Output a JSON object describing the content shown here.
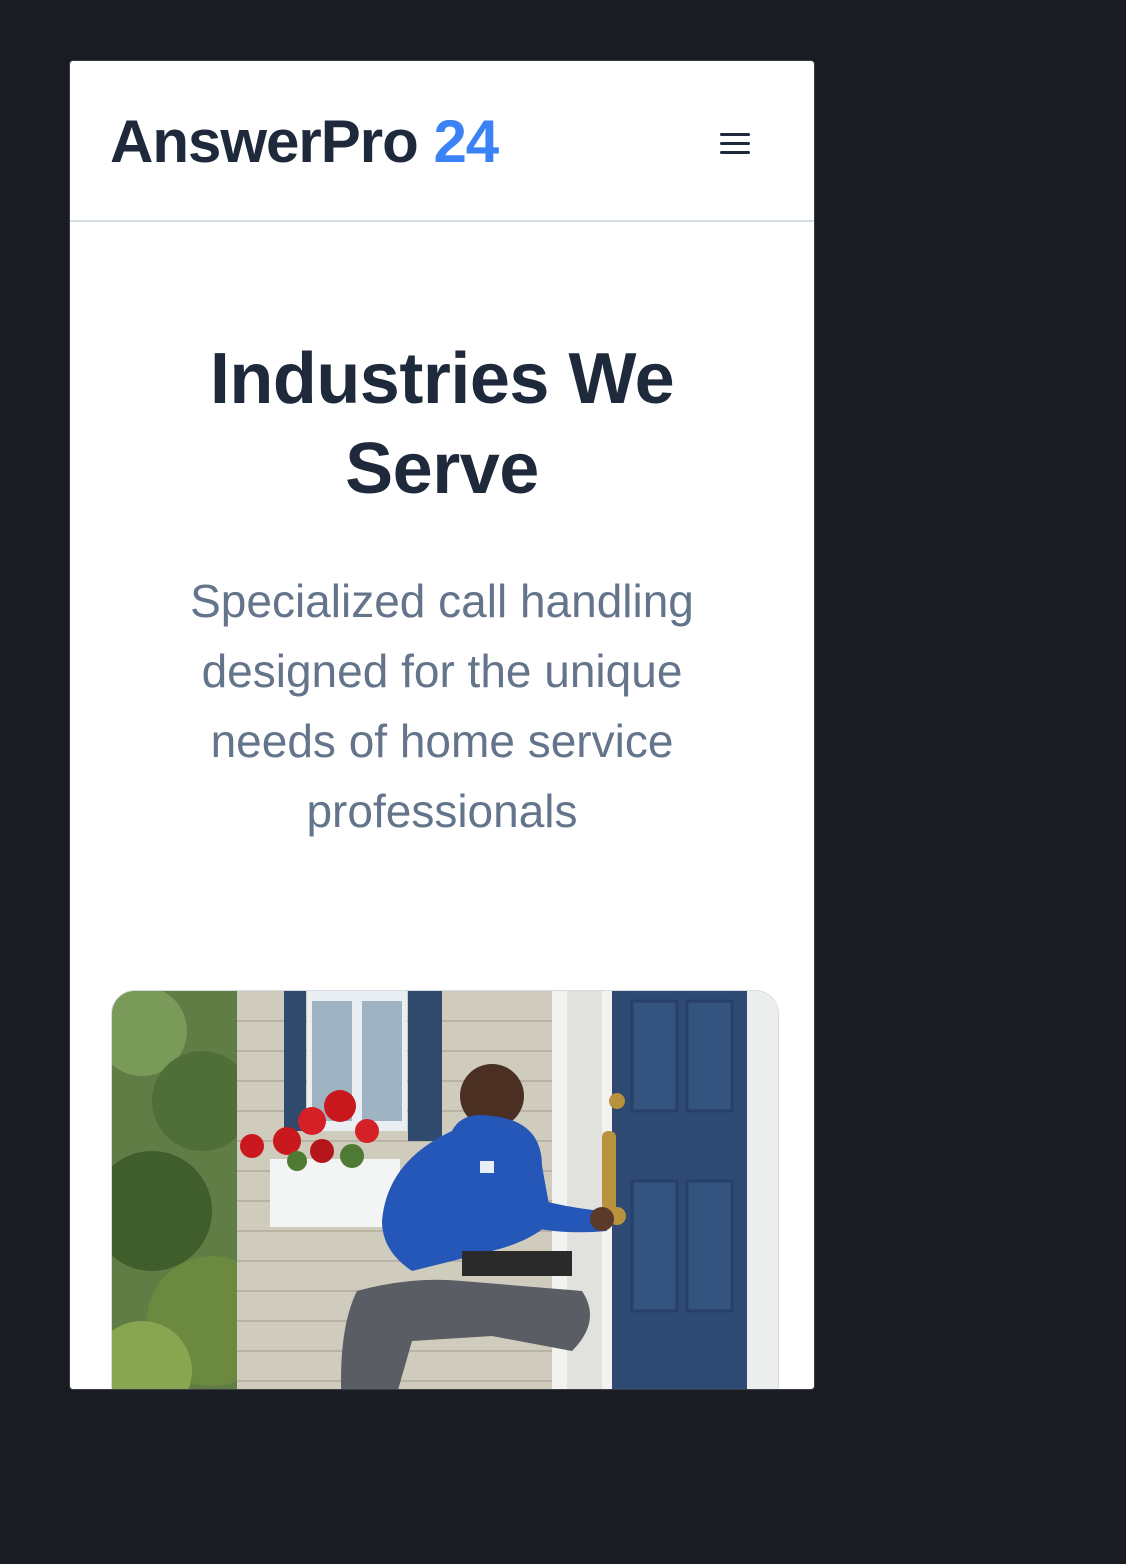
{
  "header": {
    "logo_main": "AnswerPro",
    "logo_accent": "24",
    "menu_icon": "hamburger-menu-icon"
  },
  "hero": {
    "title": "Industries We Serve",
    "subtitle": "Specialized call handling designed for the unique needs of home service professionals"
  },
  "image": {
    "alt": "Technician in blue polo installing a lock on a blue front door"
  },
  "colors": {
    "background": "#1a1c24",
    "text_dark": "#1e293b",
    "text_muted": "#64748b",
    "accent": "#3b82f6"
  }
}
